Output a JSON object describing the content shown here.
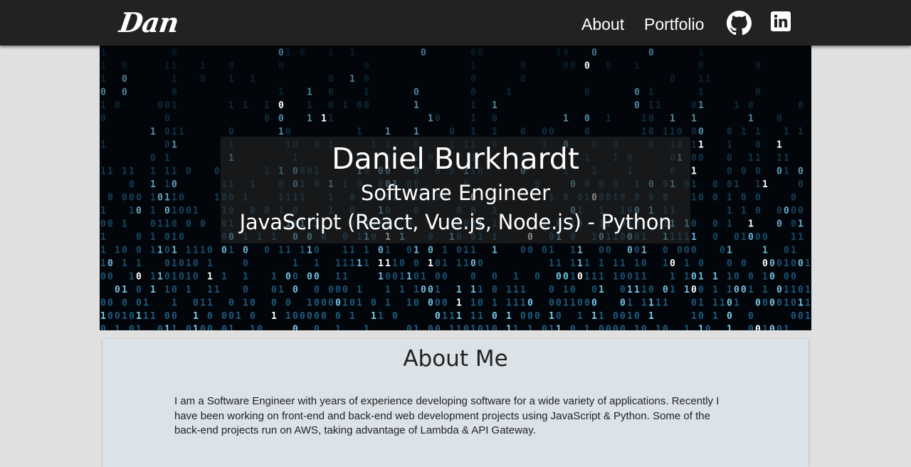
{
  "header": {
    "logo": "Dan",
    "nav": {
      "about": "About",
      "portfolio": "Portfolio"
    },
    "icons": [
      "github-icon",
      "linkedin-icon"
    ]
  },
  "hero": {
    "name": "Daniel Burkhardt",
    "role": "Software Engineer",
    "skills": "JavaScript (React, Vue.js, Node.js) - Python"
  },
  "about": {
    "title": "About Me",
    "body": "I am a Software Engineer with years of experience developing software for a wide variety of applications. Recently I have been working on front-end and back-end web development projects using JavaScript & Python. Some of the back-end projects run on AWS, taking advantage of Lambda & API Gateway."
  },
  "colors": {
    "header_bg": "#222222",
    "page_bg": "#e0e0e0",
    "card_bg": "#dbe2e8",
    "matrix_blue": "#3fb3e6"
  }
}
